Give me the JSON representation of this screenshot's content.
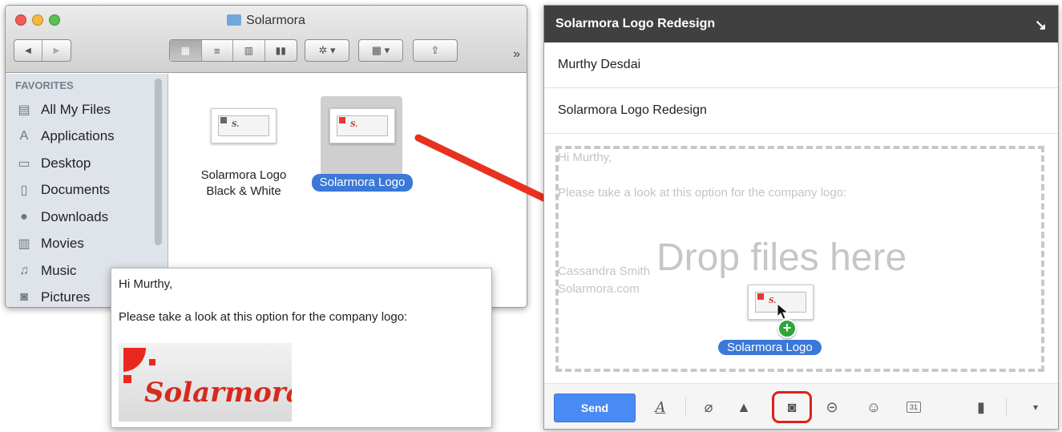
{
  "finder": {
    "title": "Solarmora",
    "toolbar": {
      "back": "◀",
      "forward": "▶",
      "action": "✲ ▾",
      "arrange": "▦ ▾",
      "share": "⇪",
      "more": "»"
    },
    "sidebar": {
      "heading": "FAVORITES",
      "items": [
        {
          "label": "All My Files",
          "icon": "all-files-icon",
          "glyph": "▤"
        },
        {
          "label": "Applications",
          "icon": "applications-icon",
          "glyph": "A"
        },
        {
          "label": "Desktop",
          "icon": "desktop-icon",
          "glyph": "▭"
        },
        {
          "label": "Documents",
          "icon": "documents-icon",
          "glyph": "▯"
        },
        {
          "label": "Downloads",
          "icon": "downloads-icon",
          "glyph": "●"
        },
        {
          "label": "Movies",
          "icon": "movies-icon",
          "glyph": "▥"
        },
        {
          "label": "Music",
          "icon": "music-icon",
          "glyph": "♫"
        },
        {
          "label": "Pictures",
          "icon": "pictures-icon",
          "glyph": "◙"
        }
      ]
    },
    "files": [
      {
        "label_line1": "Solarmora Logo",
        "label_line2": "Black & White"
      },
      {
        "label": "Solarmora Logo"
      }
    ]
  },
  "preview": {
    "greeting": "Hi Murthy,",
    "message": "Please take a look at this option for the company logo:",
    "logo_text": "Solarmora"
  },
  "compose": {
    "title": "Solarmora Logo Redesign",
    "to": "Murthy Desdai",
    "subject": "Solarmora Logo Redesign",
    "body_ghost": {
      "greeting": "Hi Murthy,",
      "message": "Please take a look at this option for the company logo:",
      "sig_name": "Cassandra Smith",
      "sig_site": "Solarmora.com"
    },
    "drop_text": "Drop files here",
    "drag_label": "Solarmora Logo",
    "send_label": "Send",
    "pop_out": "↘",
    "footer_glyphs": {
      "format": "A",
      "attach": "⌀",
      "drive": "▲",
      "photo": "◙",
      "link": "⊝",
      "emoji": "☺",
      "calendar": "31",
      "trash": "▮",
      "more": "▾"
    }
  },
  "colors": {
    "accent_blue": "#3b78d8",
    "send_blue": "#4a8af4",
    "arrow_red": "#e8321e",
    "highlight_red": "#e0201a"
  }
}
